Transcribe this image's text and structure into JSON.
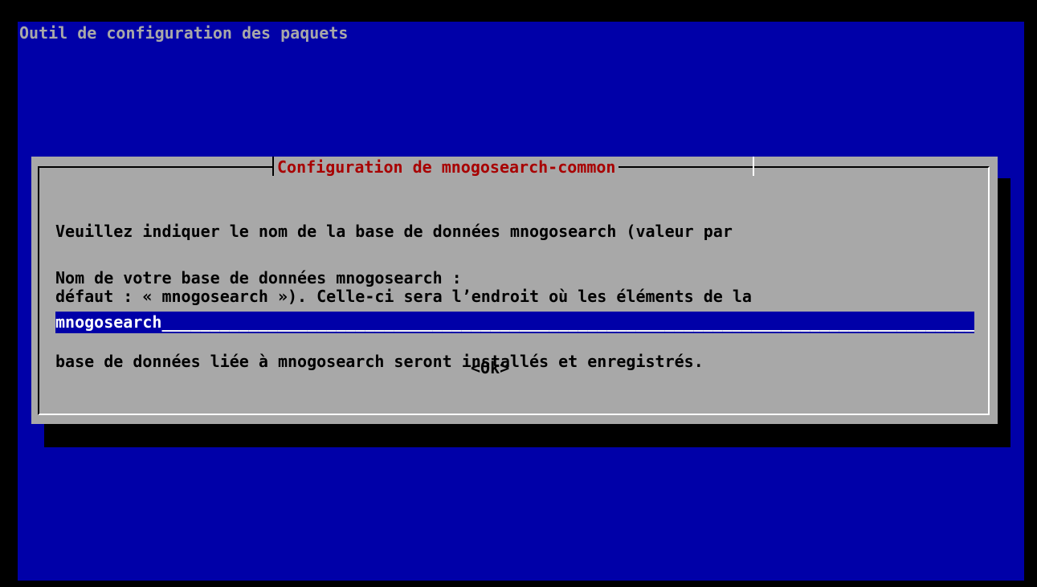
{
  "app": {
    "title": "Outil de configuration des paquets"
  },
  "dialog": {
    "title": "Configuration de mnogosearch-common",
    "description_lines": [
      "Veuillez indiquer le nom de la base de données mnogosearch (valeur par",
      "défaut : « mnogosearch »). Celle-ci sera l’endroit où les éléments de la",
      "base de données liée à mnogosearch seront installés et enregistrés."
    ],
    "prompt": "Nom de votre base de données mnogosearch :",
    "input": {
      "value": "mnogosearch",
      "fill": "_________________________________________________________________________________________________________"
    },
    "ok_label": "<Ok>"
  },
  "colors": {
    "background": "#0000a8",
    "dialog": "#a8a8a8",
    "title_text": "#a80000",
    "input_bg": "#0000a8",
    "input_text": "#ffffff"
  }
}
